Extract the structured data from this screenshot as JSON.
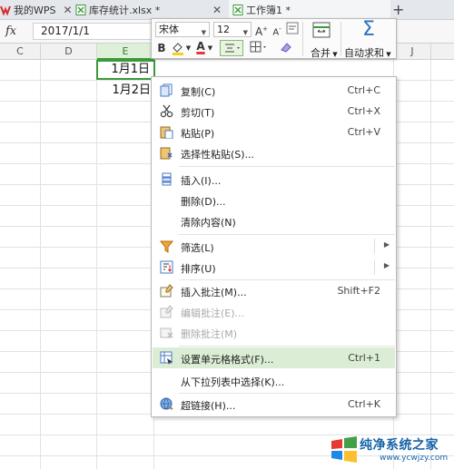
{
  "tabs": [
    {
      "label": "我的WPS",
      "icon": "wps-icon"
    },
    {
      "label": "库存统计.xlsx *",
      "icon": "spreadsheet-file-icon"
    },
    {
      "label": "工作簿1 *",
      "icon": "spreadsheet-file-icon"
    }
  ],
  "formula_bar": {
    "fx_label": "fx",
    "value": "2017/1/1"
  },
  "columns": [
    "C",
    "D",
    "E",
    "F",
    "J"
  ],
  "cells": {
    "e1": "1月1日",
    "e2": "1月2日"
  },
  "mini_toolbar": {
    "font_name": "宋体",
    "font_size": "12",
    "bold_label": "B",
    "merge_label": "合并",
    "autosum_label": "自动求和",
    "accent_color": "#3a9a3a"
  },
  "context_menu": {
    "items": [
      {
        "label": "复制(C)",
        "shortcut": "Ctrl+C",
        "icon": "copy-icon"
      },
      {
        "label": "剪切(T)",
        "shortcut": "Ctrl+X",
        "icon": "scissors-icon"
      },
      {
        "label": "粘贴(P)",
        "shortcut": "Ctrl+V",
        "icon": "paste-icon"
      },
      {
        "label": "选择性粘贴(S)...",
        "shortcut": "",
        "icon": "paste-special-icon"
      },
      {
        "label": "插入(I)...",
        "shortcut": "",
        "icon": "insert-icon"
      },
      {
        "label": "删除(D)...",
        "shortcut": "",
        "icon": ""
      },
      {
        "label": "清除内容(N)",
        "shortcut": "",
        "icon": ""
      },
      {
        "label": "筛选(L)",
        "shortcut": "",
        "icon": "filter-icon"
      },
      {
        "label": "排序(U)",
        "shortcut": "",
        "icon": "sort-icon"
      },
      {
        "label": "插入批注(M)...",
        "shortcut": "Shift+F2",
        "icon": "insert-comment-icon"
      },
      {
        "label": "编辑批注(E)...",
        "shortcut": "",
        "icon": "edit-comment-icon"
      },
      {
        "label": "删除批注(M)",
        "shortcut": "",
        "icon": "delete-comment-icon"
      },
      {
        "label": "设置单元格格式(F)...",
        "shortcut": "Ctrl+1",
        "icon": "format-cells-icon"
      },
      {
        "label": "从下拉列表中选择(K)...",
        "shortcut": "",
        "icon": ""
      },
      {
        "label": "超链接(H)...",
        "shortcut": "Ctrl+K",
        "icon": "hyperlink-icon"
      }
    ],
    "highlight_color": "#dcedd5"
  },
  "watermark": {
    "title": "纯净系统之家",
    "url": "www.ycwjzy.com"
  }
}
